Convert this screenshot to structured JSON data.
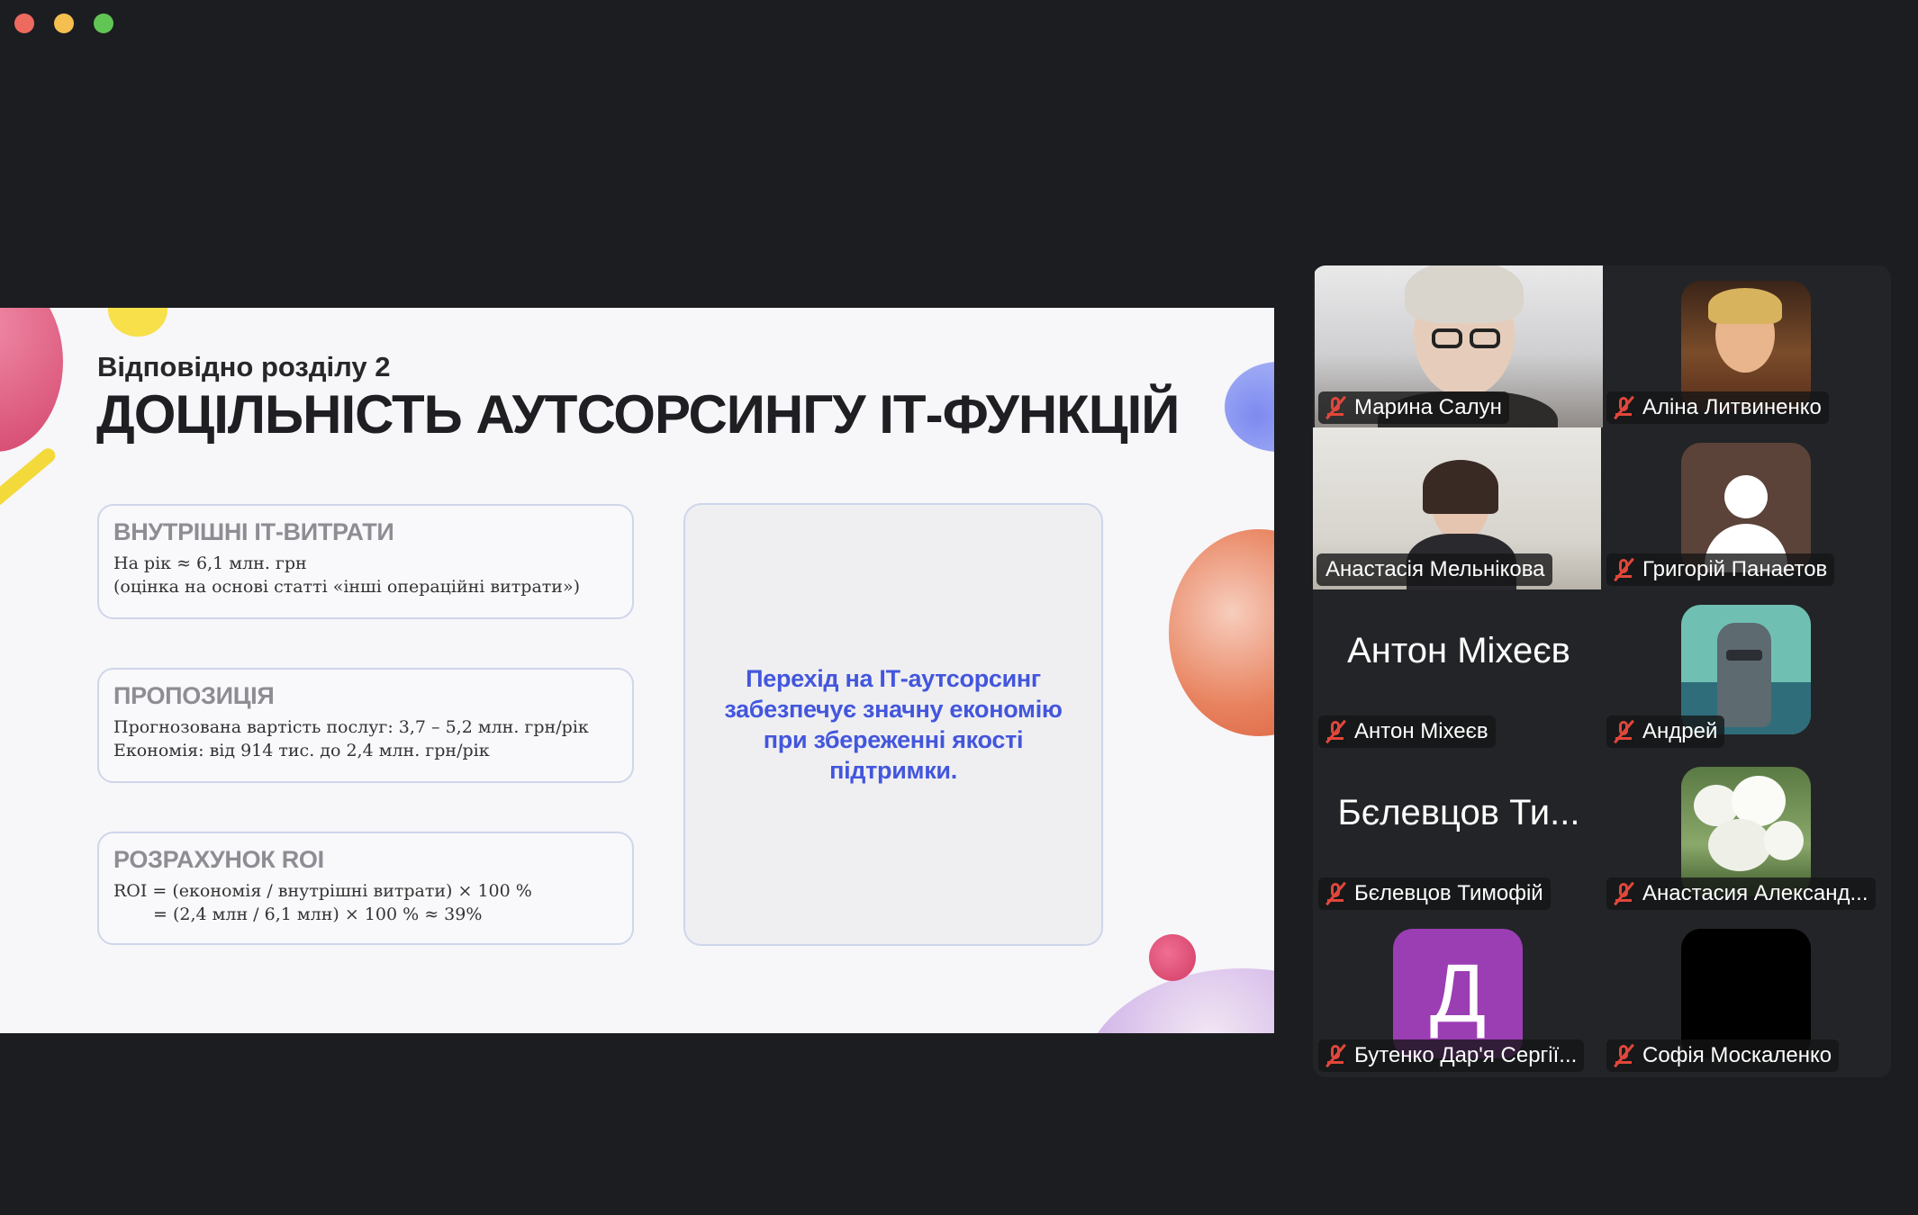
{
  "window": {
    "controls": [
      "close",
      "minimize",
      "maximize"
    ],
    "colors": {
      "close": "#ec6a5e",
      "minimize": "#f4bf4f",
      "maximize": "#61c554"
    }
  },
  "slide": {
    "subtitle": "Відповідно розділу 2",
    "title": "ДОЦІЛЬНІСТЬ АУТСОРСИНГУ ІТ-ФУНКЦІЙ",
    "cards": [
      {
        "heading": "ВНУТРІШНІ ІТ-ВИТРАТИ",
        "lines": [
          "На рік ≈ 6,1 млн. грн",
          "(оцінка на основі статті «інші операційні витрати»)"
        ]
      },
      {
        "heading": "ПРОПОЗИЦІЯ",
        "lines": [
          "Прогнозована вартість послуг: 3,7 – 5,2 млн. грн/рік",
          "Економія: від 914 тис. до 2,4 млн. грн/рік"
        ]
      },
      {
        "heading": "РОЗРАХУНОК ROI",
        "lines": [
          "ROI = (економія / внутрішні витрати) × 100 %",
          "= (2,4 млн / 6,1 млн) × 100 % ≈ 39%"
        ]
      }
    ],
    "callout": "Перехід на ІТ-аутсорсинг\nзабезпечує значну економію\nпри збереженні якості\nпідтримки.",
    "accent_color": "#4356dc"
  },
  "participants": [
    {
      "name": "Марина Салун",
      "muted": true,
      "type": "video"
    },
    {
      "name": "Аліна Литвиненко",
      "muted": true,
      "type": "photo"
    },
    {
      "name": "Анастасія Мельнікова",
      "muted": false,
      "type": "video",
      "active_speaker": true
    },
    {
      "name": "Григорій Панаетов",
      "muted": true,
      "type": "avatar"
    },
    {
      "name": "Антон Міхеєв",
      "display": "Антон Міхеєв",
      "muted": true,
      "type": "name"
    },
    {
      "name": "Андрей",
      "muted": true,
      "type": "photo"
    },
    {
      "name": "Бєлевцов Тимофій",
      "display": "Бєлевцов Ти...",
      "muted": true,
      "type": "name"
    },
    {
      "name": "Анастасия Александ...",
      "muted": true,
      "type": "photo"
    },
    {
      "name": "Бутенко Дар'я Сергії...",
      "initial": "Д",
      "muted": true,
      "type": "initial"
    },
    {
      "name": "Софія Москаленко",
      "muted": true,
      "type": "photo"
    }
  ]
}
